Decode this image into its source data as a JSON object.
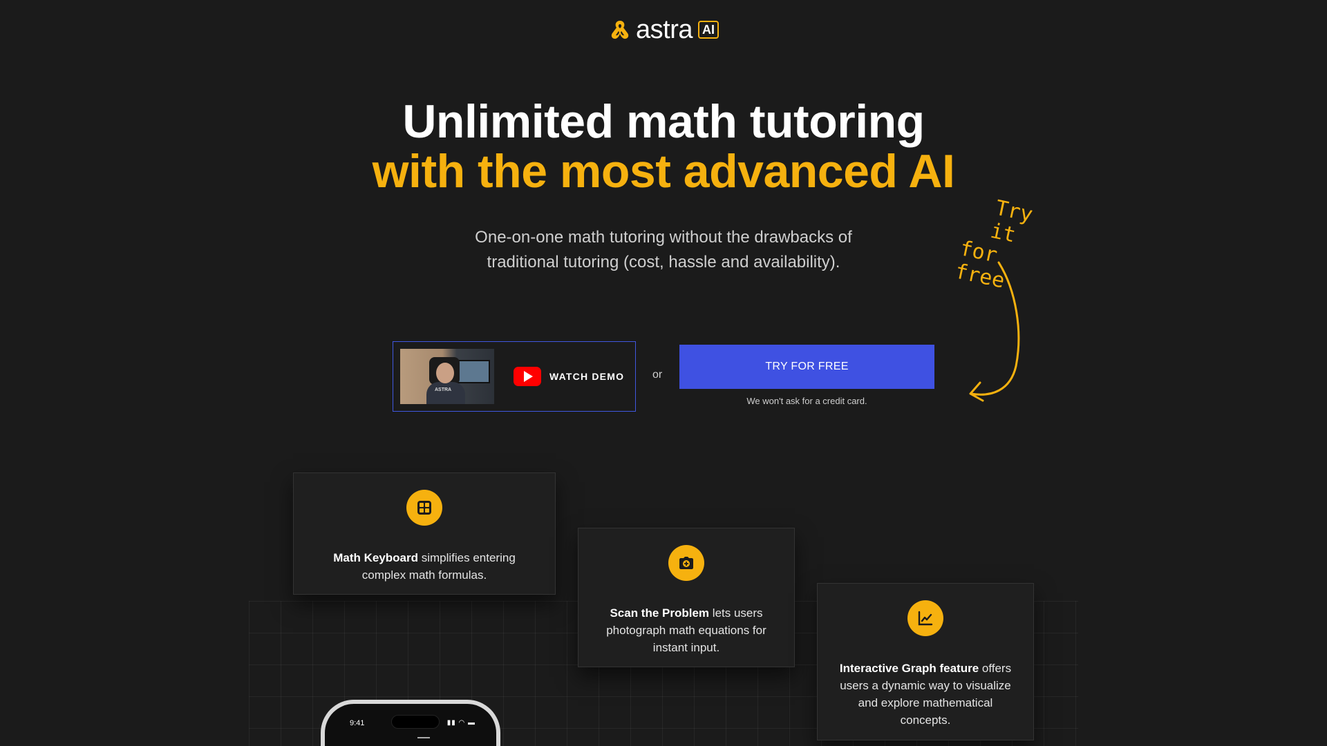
{
  "header": {
    "logo_text": "astra",
    "logo_badge": "AI"
  },
  "hero": {
    "title_line1": "Unlimited math tutoring",
    "title_line2": "with the most advanced AI",
    "subtitle": "One-on-one math tutoring without the drawbacks of traditional tutoring (cost, hassle and availability).",
    "handwritten_line1": "Try it",
    "handwritten_line2": "for free"
  },
  "cta": {
    "demo_shirt_text": "ASTRA",
    "watch_demo_label": "WATCH DEMO",
    "or_text": "or",
    "try_free_label": "TRY FOR FREE",
    "credit_note": "We won't ask for a credit card."
  },
  "features": [
    {
      "bold": "Math Keyboard",
      "text": " simplifies entering complex math formulas.",
      "icon": "calculator-icon"
    },
    {
      "bold": "Scan the Problem",
      "text": " lets users photograph math equations for instant input.",
      "icon": "camera-icon"
    },
    {
      "bold": "Interactive Graph feature",
      "text": " offers users a dynamic way to visualize and explore mathematical concepts.",
      "icon": "chart-icon"
    }
  ],
  "phone": {
    "time": "9:41"
  },
  "colors": {
    "background": "#1b1b1b",
    "accent": "#f6b10f",
    "primary_button": "#3f51e2"
  }
}
